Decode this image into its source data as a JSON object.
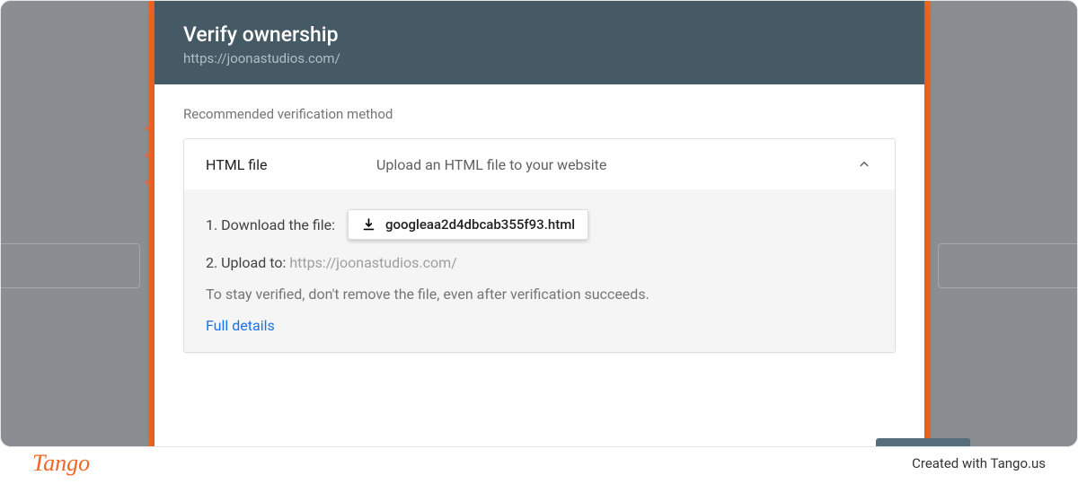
{
  "dialog": {
    "title": "Verify ownership",
    "subtitle": "https://joonastudios.com/",
    "section_label": "Recommended verification method",
    "method": {
      "title": "HTML file",
      "description": "Upload an HTML file to your website",
      "step1_label": "1. Download the file:",
      "download_file": "googleaa2d4dbcab355f93.html",
      "step2_label": "2. Upload to:",
      "upload_url": "https://joonastudios.com/",
      "note": "To stay verified, don't remove the file, even after verification succeeds.",
      "details_link": "Full details"
    }
  },
  "footer": {
    "brand": "Tango",
    "credit": "Created with Tango.us"
  }
}
